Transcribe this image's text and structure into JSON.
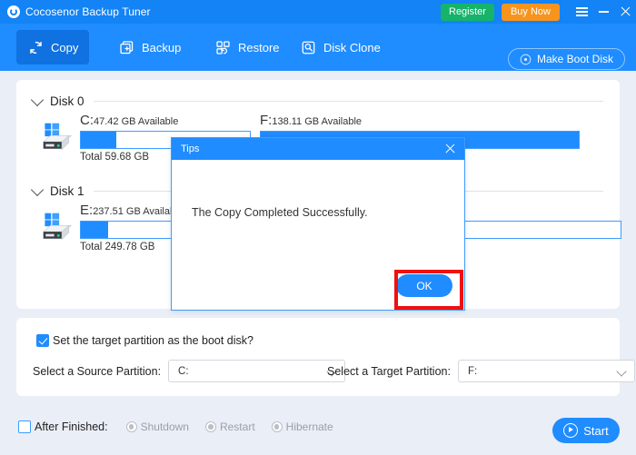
{
  "window": {
    "title": "Cocosenor Backup Tuner",
    "logo_icon": "refresh-circle-icon",
    "register_label": "Register",
    "buy_now_label": "Buy Now",
    "menu_icon": "hamburger-icon",
    "minimize_icon": "minimize-icon",
    "close_icon": "close-icon",
    "accent_color": "#1f8cff",
    "titlebar_color": "#1383f5",
    "register_color": "#16b36b",
    "buy_now_color": "#f7941e"
  },
  "toolbar": {
    "items": [
      {
        "label": "Copy",
        "icon": "copy-refresh-icon",
        "active": true
      },
      {
        "label": "Backup",
        "icon": "backup-plus-icon",
        "active": false
      },
      {
        "label": "Restore",
        "icon": "restore-grid-icon",
        "active": false
      },
      {
        "label": "Disk Clone",
        "icon": "disk-clone-icon",
        "active": false
      }
    ],
    "make_boot_disk_label": "Make Boot Disk",
    "make_boot_disk_icon": "boot-disk-icon"
  },
  "disks": [
    {
      "name": "Disk 0",
      "icon": "windows-hard-disk-icon",
      "expanded": true,
      "partitions": [
        {
          "letter": "C:",
          "available": "47.42 GB Available",
          "total": "Total 59.68 GB",
          "used_percent": 21
        },
        {
          "letter": "F:",
          "available": "138.11 GB Available",
          "total": "",
          "used_percent": 100
        }
      ]
    },
    {
      "name": "Disk 1",
      "icon": "windows-hard-disk-icon",
      "expanded": true,
      "partitions": [
        {
          "letter": "E:",
          "available": "237.51 GB Available",
          "total": "Total 249.78 GB",
          "used_percent": 5
        }
      ]
    }
  ],
  "options": {
    "boot_disk_checkbox_label": "Set the target partition as the boot disk?",
    "boot_disk_checked": true,
    "source_label": "Select a Source Partition:",
    "source_value": "C:",
    "target_label": "Select a Target Partition:",
    "target_value": "F:"
  },
  "footer": {
    "after_finished_label": "After Finished:",
    "after_finished_checked": false,
    "radios": [
      {
        "label": "Shutdown",
        "selected": false
      },
      {
        "label": "Restart",
        "selected": false
      },
      {
        "label": "Hibernate",
        "selected": false
      }
    ],
    "start_label": "Start",
    "start_icon": "play-circle-icon"
  },
  "dialog": {
    "title": "Tips",
    "close_icon": "close-icon",
    "message": "The Copy Completed Successfully.",
    "ok_label": "OK",
    "highlight_color": "#ee1111"
  }
}
